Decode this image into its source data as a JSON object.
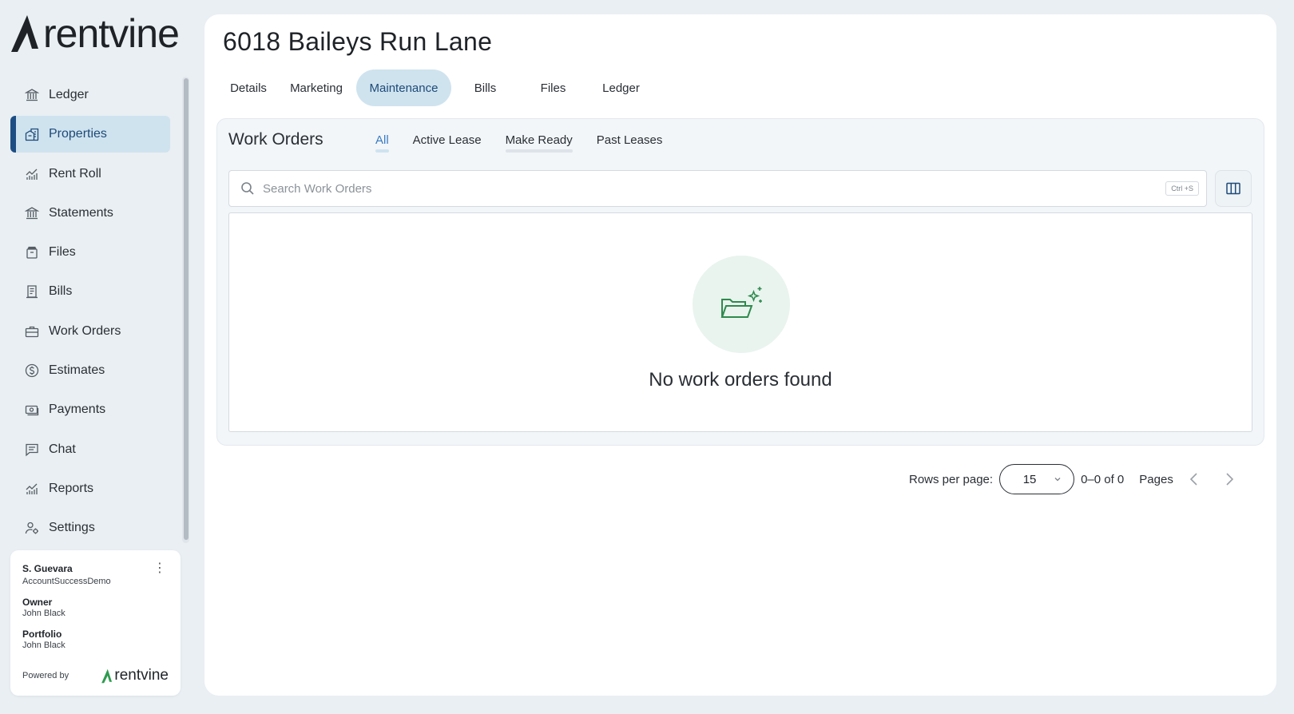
{
  "brand": {
    "name": "rentvine",
    "color": "#1f2328",
    "accent": "#2e9b4f"
  },
  "sidebar": {
    "items": [
      {
        "label": "Ledger",
        "icon": "bank-icon"
      },
      {
        "label": "Properties",
        "icon": "building-icon",
        "active": true
      },
      {
        "label": "Rent Roll",
        "icon": "chart-icon"
      },
      {
        "label": "Statements",
        "icon": "bank-icon"
      },
      {
        "label": "Files",
        "icon": "archive-icon"
      },
      {
        "label": "Bills",
        "icon": "receipt-icon"
      },
      {
        "label": "Work Orders",
        "icon": "toolbox-icon"
      },
      {
        "label": "Estimates",
        "icon": "dollar-circle-icon"
      },
      {
        "label": "Payments",
        "icon": "cash-icon"
      },
      {
        "label": "Chat",
        "icon": "chat-icon"
      },
      {
        "label": "Reports",
        "icon": "chart-icon"
      },
      {
        "label": "Settings",
        "icon": "user-gear-icon"
      }
    ]
  },
  "user_card": {
    "name": "S. Guevara",
    "org": "AccountSuccessDemo",
    "owner_label": "Owner",
    "owner_value": "John Black",
    "portfolio_label": "Portfolio",
    "portfolio_value": "John Black",
    "powered_by": "Powered by",
    "powered_brand": "rentvine"
  },
  "main": {
    "title": "6018 Baileys Run Lane",
    "tabs": [
      {
        "label": "Details"
      },
      {
        "label": "Marketing"
      },
      {
        "label": "Maintenance",
        "active": true
      },
      {
        "label": "Bills"
      },
      {
        "label": "Files"
      },
      {
        "label": "Ledger"
      }
    ]
  },
  "work_orders": {
    "title": "Work Orders",
    "subtabs": [
      {
        "label": "All",
        "active": true
      },
      {
        "label": "Active Lease"
      },
      {
        "label": "Make Ready",
        "underlined": true
      },
      {
        "label": "Past Leases"
      }
    ],
    "search_placeholder": "Search Work Orders",
    "search_shortcut": "Ctrl +S",
    "empty_text": "No work orders found"
  },
  "pager": {
    "rows_label": "Rows per page:",
    "rows_value": "15",
    "range": "0–0 of 0",
    "pages_label": "Pages"
  }
}
